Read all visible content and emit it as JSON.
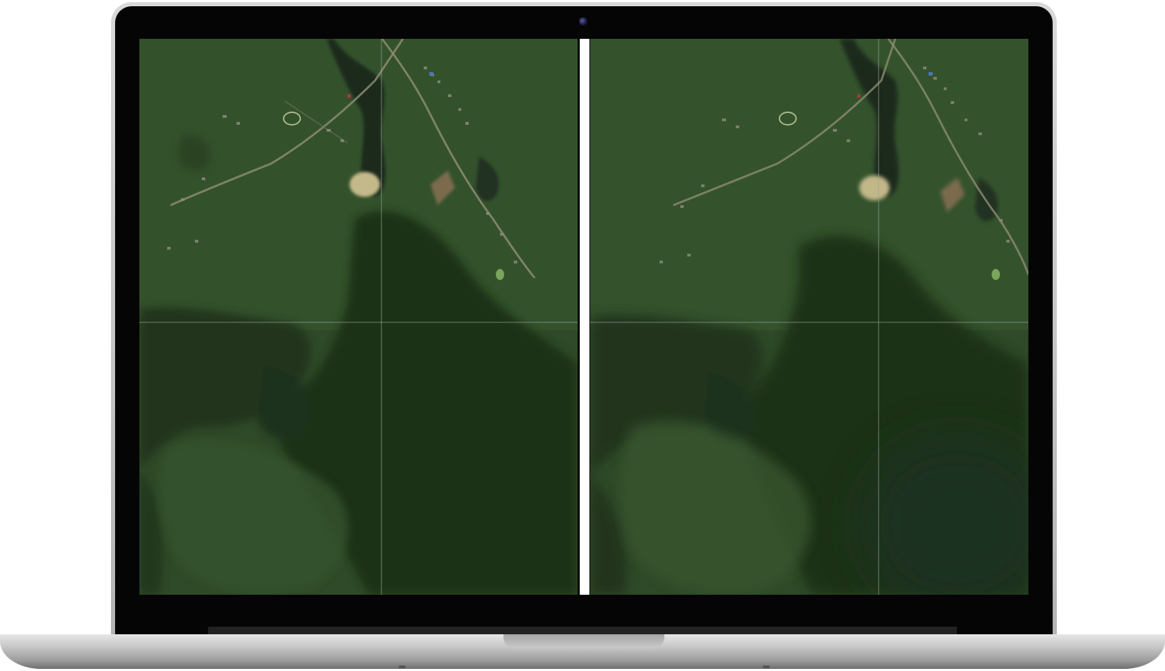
{
  "device": {
    "frame": "laptop",
    "colors": {
      "aluminum": "#c8c8c8",
      "bezel": "#050505",
      "divider": "#ffffff"
    }
  },
  "viewer": {
    "mode": "side-by-side-comparison",
    "panes": [
      {
        "id": "left",
        "content": "satellite-image"
      },
      {
        "id": "right",
        "content": "satellite-image"
      }
    ],
    "crosshair_color": "#9aa19a",
    "colors": {
      "grass": "#2e4a27",
      "forest": "#1b2e18",
      "road": "#8a8c74",
      "water": "#1c2a1b"
    }
  }
}
